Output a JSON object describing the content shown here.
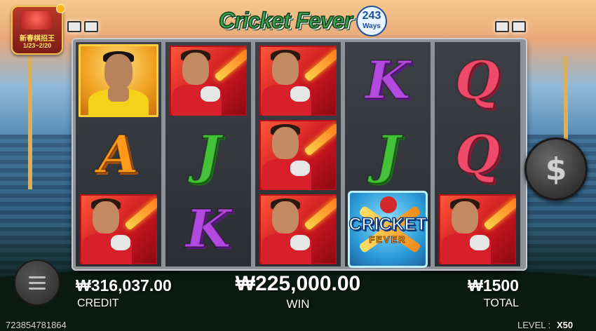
{
  "promo": {
    "line1": "新春棋招王",
    "line2": "1/23~2/20"
  },
  "logo": {
    "title": "Cricket Fever",
    "ways_number": "243",
    "ways_label": "Ways"
  },
  "reels": [
    [
      "captain",
      "A",
      "player"
    ],
    [
      "player",
      "J",
      "K"
    ],
    [
      "player",
      "player",
      "player"
    ],
    [
      "K",
      "J",
      "logo"
    ],
    [
      "Q",
      "Q",
      "player"
    ]
  ],
  "logo_symbol": {
    "line1": "CRICKET",
    "line2": "FEVER"
  },
  "spin": {
    "label": "$"
  },
  "credit": {
    "value": "₩316,037.00",
    "label": "CREDIT"
  },
  "win": {
    "value": "₩225,000.00",
    "label": "WIN"
  },
  "total": {
    "value": "₩1500",
    "label": "TOTAL"
  },
  "footer": {
    "round_id": "723854781864",
    "level_label": "LEVEL :",
    "level_value": "X50"
  },
  "colors": {
    "letter_A": "#ff9a1a",
    "letter_J": "#44c23a",
    "letter_K": "#b24ae0",
    "letter_Q": "#f04a6a",
    "reel_bg": "#2b2e33"
  }
}
